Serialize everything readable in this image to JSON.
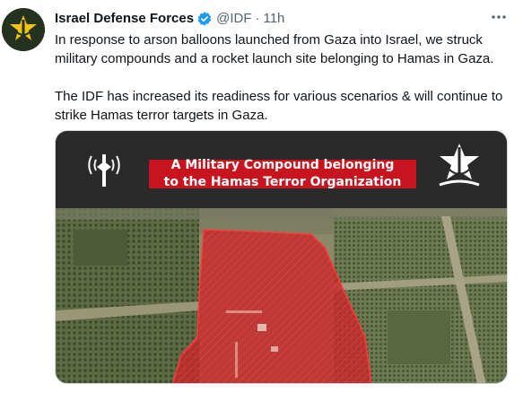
{
  "tweet": {
    "author_name": "Israel Defense Forces",
    "handle": "@IDF",
    "separator": "·",
    "time": "11h",
    "paragraph1": "In response to arson balloons launched from Gaza into Israel, we struck military compounds and a rocket launch site belonging to Hamas in Gaza.",
    "paragraph2": "The IDF has increased its readiness for various scenarios & will continue to strike Hamas terror targets in Gaza."
  },
  "icons": {
    "avatar": "idf-emblem-icon",
    "verified": "verified-badge-icon",
    "more": "more-options-icon"
  },
  "media": {
    "banner_line1": "A Military Compound belonging",
    "banner_line2": "to the Hamas Terror Organization"
  },
  "colors": {
    "verified_blue": "#1d9bf0",
    "banner_red": "#c8141e",
    "overlay_red": "#d2282a",
    "header_dark": "#2a2a2a"
  }
}
